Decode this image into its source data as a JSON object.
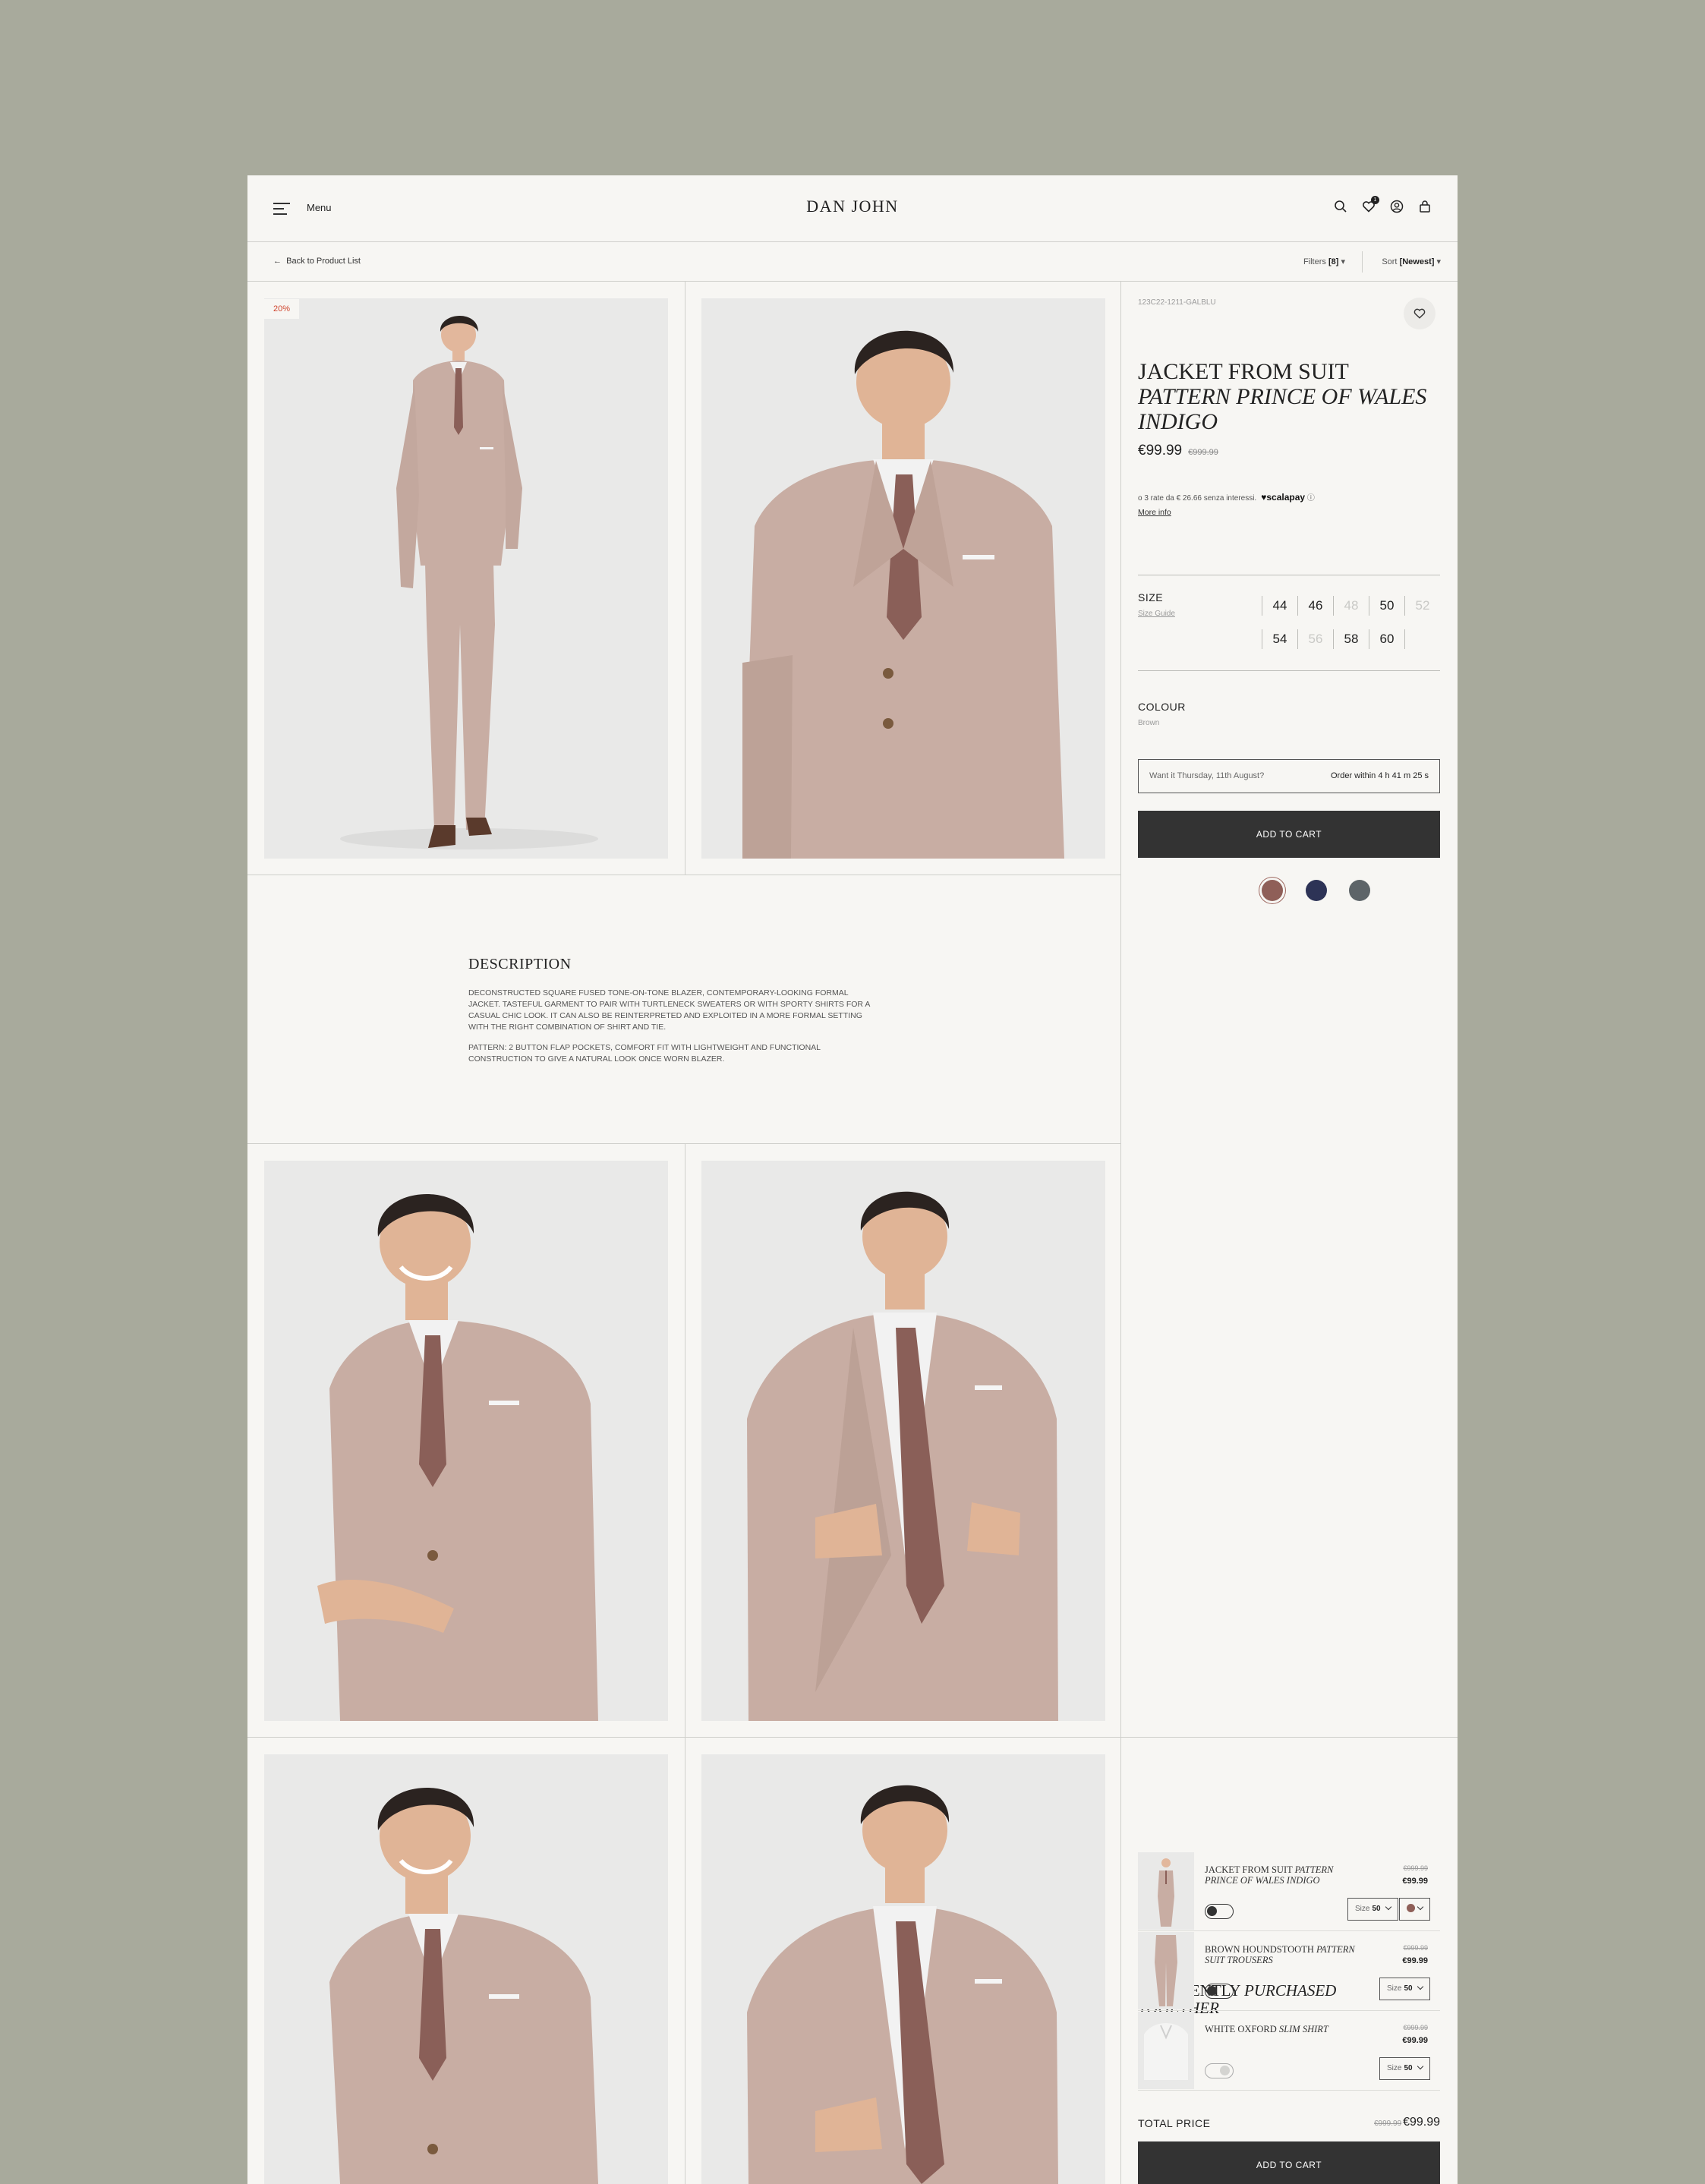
{
  "header": {
    "menu_label": "Menu",
    "brand": "DAN JOHN",
    "wishlist_count": "1"
  },
  "subbar": {
    "back_label": "Back to Product List",
    "filters_label": "Filters",
    "filters_count": "[8]",
    "sort_label": "Sort",
    "sort_value": "[Newest]"
  },
  "gallery": {
    "sale_badge": "20%"
  },
  "description": {
    "title": "DESCRIPTION",
    "paragraph1": "DECONSTRUCTED SQUARE FUSED TONE-ON-TONE BLAZER, CONTEMPORARY-LOOKING FORMAL JACKET. TASTEFUL GARMENT TO PAIR WITH TURTLENECK SWEATERS OR WITH SPORTY SHIRTS FOR A CASUAL CHIC LOOK. IT CAN ALSO BE REINTERPRETED AND EXPLOITED IN A MORE FORMAL SETTING WITH THE RIGHT COMBINATION OF SHIRT AND TIE.",
    "paragraph2": "PATTERN: 2 BUTTON FLAP POCKETS, COMFORT FIT WITH LIGHTWEIGHT AND FUNCTIONAL CONSTRUCTION TO GIVE A NATURAL LOOK ONCE WORN BLAZER."
  },
  "product": {
    "sku": "123C22-1211-GALBLU",
    "title_line1": "JACKET FROM SUIT",
    "title_line2": "PATTERN PRINCE OF WALES",
    "title_line3": "INDIGO",
    "price": "€99.99",
    "old_price": "€999.99",
    "installments": "o 3 rate da € 26.66 senza interessi.",
    "installment_brand": "♥scalapay",
    "more_info": "More info",
    "size_label": "SIZE",
    "size_guide": "Size Guide",
    "sizes_row1": [
      {
        "label": "44",
        "available": true
      },
      {
        "label": "46",
        "available": true
      },
      {
        "label": "48",
        "available": false
      },
      {
        "label": "50",
        "available": true
      },
      {
        "label": "52",
        "available": false
      }
    ],
    "sizes_row2": [
      {
        "label": "54",
        "available": true
      },
      {
        "label": "56",
        "available": false
      },
      {
        "label": "58",
        "available": true
      },
      {
        "label": "60",
        "available": true
      }
    ],
    "colour_label": "COLOUR",
    "colour_value": "Brown",
    "colours": [
      "#8f5f58",
      "#2d3356",
      "#5d6468"
    ],
    "delivery_question": "Want it Thursday, 11th August?",
    "delivery_timer": "Order within 4 h 41 m 25 s",
    "add_to_cart": "ADD TO CART"
  },
  "bundle": {
    "title_normal": "FREQUENTLY",
    "title_italic1": "PURCHASED",
    "title_italic2": "TOGETHER",
    "items": [
      {
        "name": "JACKET FROM SUIT",
        "name_italic": "PATTERN PRINCE OF WALES INDIGO",
        "old_price": "€999.99",
        "price": "€99.99",
        "size_label": "Size",
        "size_value": "50",
        "selected": true
      },
      {
        "name": "BROWN HOUNDSTOOTH",
        "name_italic": "PATTERN SUIT TROUSERS",
        "old_price": "€999.99",
        "price": "€99.99",
        "size_label": "Size",
        "size_value": "50",
        "selected": true
      },
      {
        "name": "WHITE OXFORD",
        "name_italic": "SLIM SHIRT",
        "old_price": "€999.99",
        "price": "€99.99",
        "size_label": "Size",
        "size_value": "50",
        "selected": false
      }
    ],
    "total_label": "TOTAL PRICE",
    "total_old": "€999.99",
    "total_price": "€99.99",
    "add_to_cart": "ADD TO CART"
  },
  "colors": {
    "background": "#a8aa9c",
    "panel": "#f7f6f3",
    "suit": "#c8ada3",
    "tie": "#8a5f58",
    "button": "#333333"
  }
}
